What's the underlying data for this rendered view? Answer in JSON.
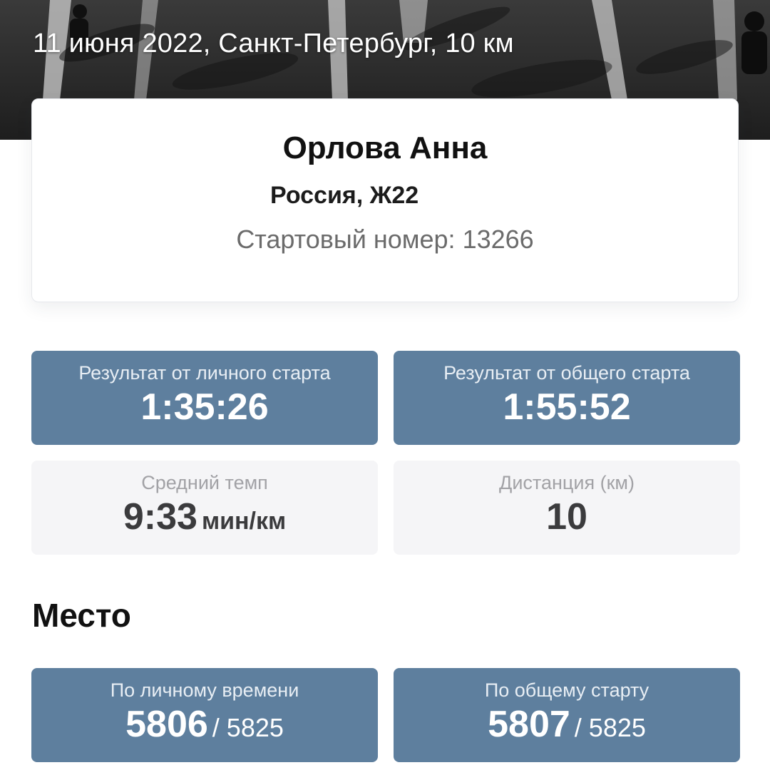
{
  "header": {
    "title": "11 июня 2022, Санкт-Петербург, 10 км"
  },
  "athlete": {
    "name": "Орлова Анна",
    "meta": "Россия, Ж22",
    "bib_label": "Стартовый номер:",
    "bib_number": "13266"
  },
  "results": {
    "personal_start": {
      "label": "Результат от личного старта",
      "value": "1:35:26"
    },
    "gun_start": {
      "label": "Результат от общего старта",
      "value": "1:55:52"
    },
    "pace": {
      "label": "Средний темп",
      "value": "9:33",
      "unit": "мин/км"
    },
    "distance": {
      "label": "Дистанция (км)",
      "value": "10"
    }
  },
  "place": {
    "title": "Место",
    "personal_time": {
      "label": "По личному времени",
      "rank": "5806",
      "total": "/ 5825"
    },
    "gun_time": {
      "label": "По общему старту",
      "rank": "5807",
      "total": "/ 5825"
    }
  },
  "colors": {
    "accent_tile": "#5e7f9e",
    "neutral_tile": "#f5f5f7",
    "hero_background": "#2a2a2a"
  }
}
